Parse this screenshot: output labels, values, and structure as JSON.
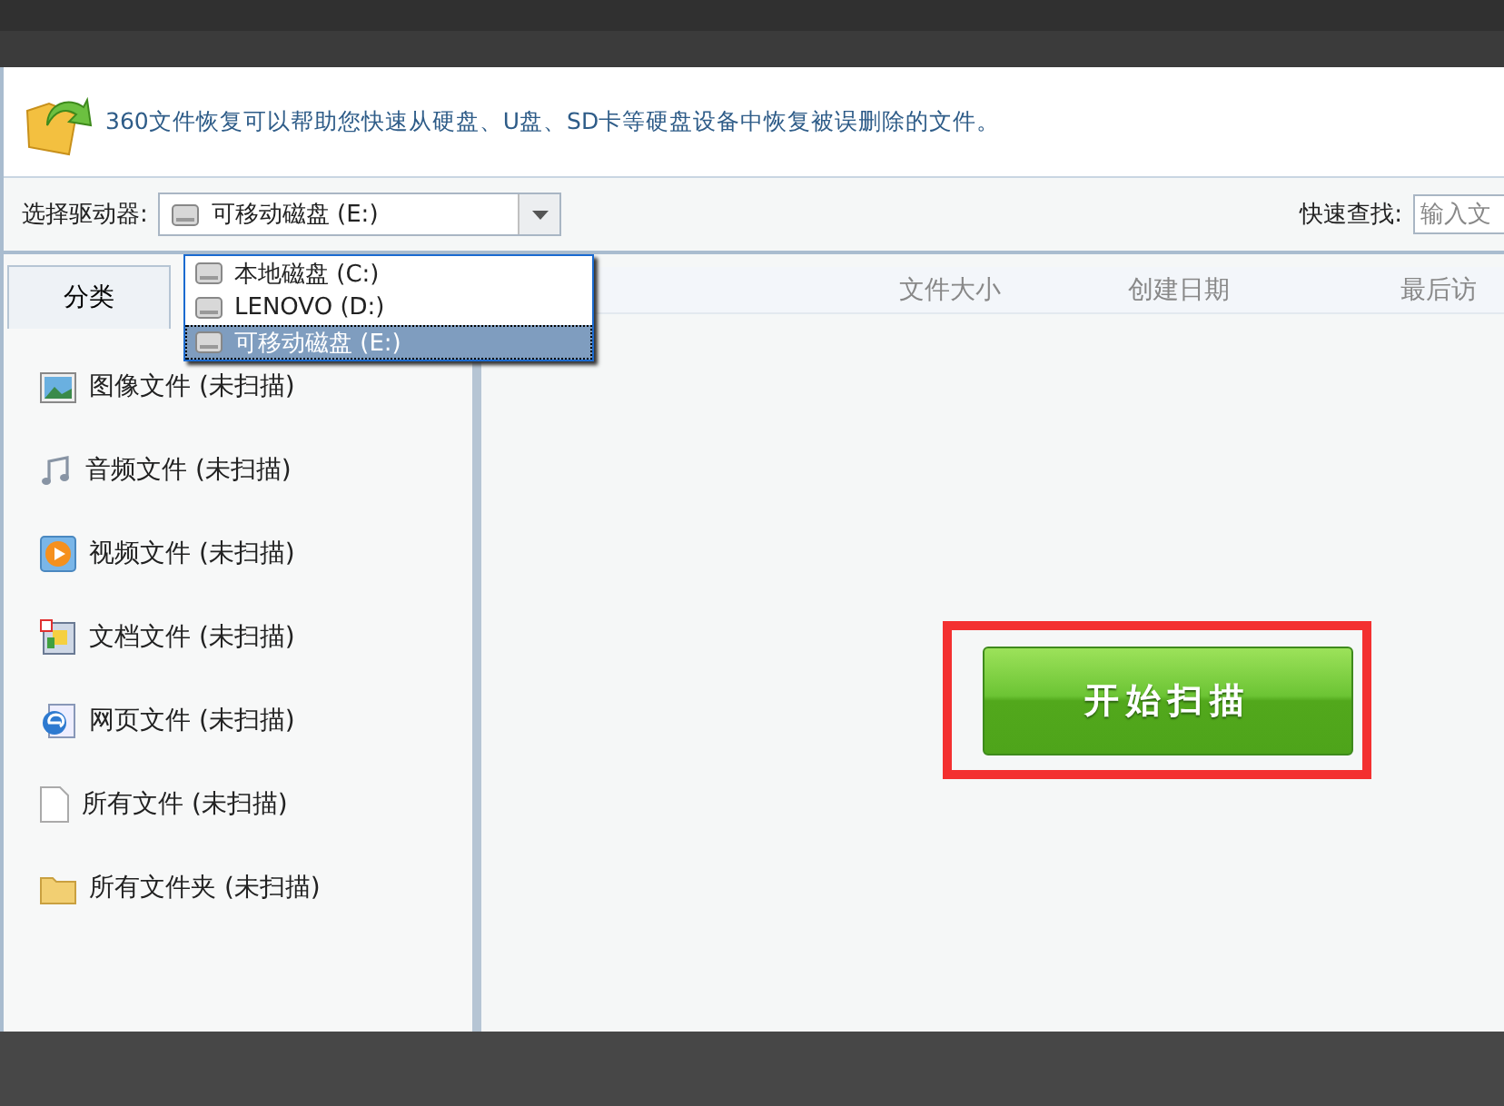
{
  "banner": {
    "text": "360文件恢复可以帮助您快速从硬盘、U盘、SD卡等硬盘设备中恢复被误删除的文件。"
  },
  "toolbar": {
    "drive_label": "选择驱动器:",
    "drive_value": "可移动磁盘 (E:)",
    "search_label": "快速查找:",
    "search_placeholder": "输入文"
  },
  "drive_dropdown": [
    {
      "label": "本地磁盘 (C:)",
      "selected": false
    },
    {
      "label": "LENOVO (D:)",
      "selected": false
    },
    {
      "label": "可移动磁盘 (E:)",
      "selected": true
    }
  ],
  "sidebar": {
    "tab": "分类",
    "items": [
      {
        "kind": "image",
        "label": "图像文件 (未扫描)"
      },
      {
        "kind": "audio",
        "label": "音频文件 (未扫描)"
      },
      {
        "kind": "video",
        "label": "视频文件 (未扫描)"
      },
      {
        "kind": "document",
        "label": "文档文件 (未扫描)"
      },
      {
        "kind": "web",
        "label": "网页文件 (未扫描)"
      },
      {
        "kind": "file",
        "label": "所有文件 (未扫描)"
      },
      {
        "kind": "folder",
        "label": "所有文件夹 (未扫描)"
      }
    ]
  },
  "table": {
    "columns": [
      "文件大小",
      "创建日期",
      "最后访"
    ]
  },
  "scan_button": {
    "label": "开始扫描"
  }
}
